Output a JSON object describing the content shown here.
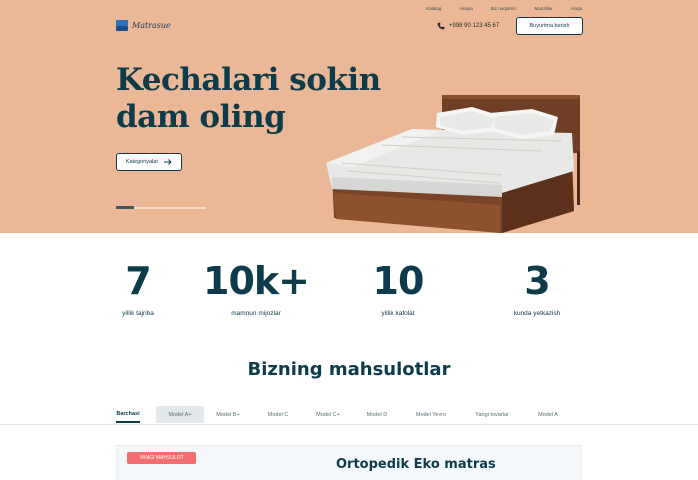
{
  "brand": {
    "name": "Matrasue"
  },
  "topnav": [
    "Katalog",
    "Aksiya",
    "Biz nuqtamiz",
    "Manzillar",
    "Aloqa"
  ],
  "header": {
    "phone": "+998 90 123 45 67",
    "order_button": "Buyurtma berish"
  },
  "hero": {
    "title_line1": "Kechalari sokin",
    "title_line2": "dam oling",
    "categories_button": "Kategoriyalar",
    "slider_position": 0.2
  },
  "stats": [
    {
      "value": "7",
      "label": "yillik tajriba"
    },
    {
      "value": "10k+",
      "label": "mamnun mijozlar"
    },
    {
      "value": "10",
      "label": "yillik kafolat"
    },
    {
      "value": "3",
      "label": "kunda yetkazish"
    }
  ],
  "products": {
    "title": "Bizning mahsulotlar",
    "tabs": [
      "Barchasi",
      "Model A+",
      "Model B+",
      "Model C",
      "Model C+",
      "Model D",
      "Model Yevro",
      "Yangi tovarlar",
      "Model A"
    ],
    "active_tab": "Barchasi"
  },
  "featured": {
    "badge": "YANGI MAHSULOT",
    "title": "Ortopedik Eko matras"
  },
  "colors": {
    "hero_bg": "#eab896",
    "primary": "#0d3b4a",
    "badge": "#f26d6d"
  },
  "icons": [
    "phone-icon",
    "arrow-right-icon",
    "logo-icon"
  ]
}
